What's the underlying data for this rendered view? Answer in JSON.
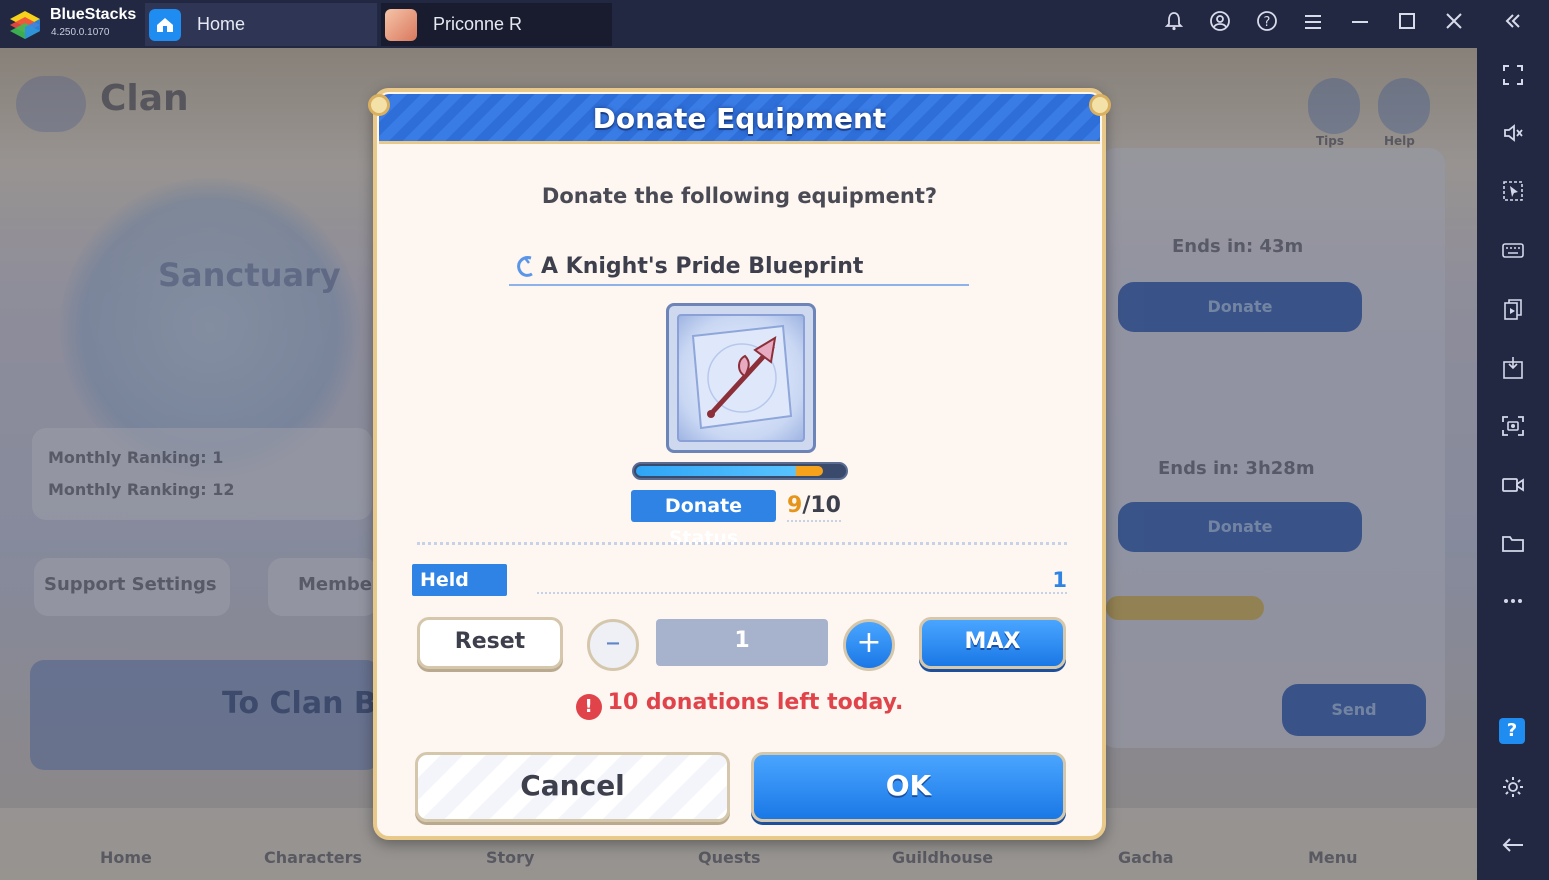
{
  "app": {
    "name": "BlueStacks",
    "version": "4.250.0.1070"
  },
  "tabs": [
    {
      "label": "Home",
      "icon": "home-icon"
    },
    {
      "label": "Priconne R",
      "icon": "game-avatar-icon"
    }
  ],
  "titlebar_icons": [
    "bell-icon",
    "account-icon",
    "help-icon",
    "hamburger-menu-icon",
    "minimize-icon",
    "maximize-icon",
    "close-icon",
    "collapse-sidebar-icon"
  ],
  "sidebar_icons": [
    "fullscreen-icon",
    "volume-mute-icon",
    "pointer-selection-icon",
    "keyboard-icon",
    "multi-instance-icon",
    "apk-install-icon",
    "screenshot-icon",
    "record-video-icon",
    "folder-icon",
    "more-icon",
    "help-icon",
    "settings-gear-icon",
    "back-arrow-icon"
  ],
  "background": {
    "screen_title": "Clan",
    "clan_crest_label": "Sanctuary",
    "rankings": [
      "Monthly Ranking: 1",
      "Monthly Ranking: 12"
    ],
    "buttons": [
      "Support Settings",
      "Membe"
    ],
    "to_clan_label": "To Clan B",
    "right_icons": [
      "Tips",
      "Help"
    ],
    "requests": [
      {
        "timer": "Ends in: 43m",
        "button": "Donate"
      },
      {
        "timer": "Ends in: 3h28m",
        "button": "Donate"
      }
    ],
    "send_button": "Send",
    "bottom_nav": [
      "Home",
      "Characters",
      "Story",
      "Quests",
      "Guildhouse",
      "Gacha",
      "Menu"
    ]
  },
  "dialog": {
    "title": "Donate Equipment",
    "question": "Donate the following equipment?",
    "item_name": "A Knight's Pride Blueprint",
    "progress_fraction": 0.9,
    "status_label": "Donate Status",
    "status_current": "9",
    "status_total": "/10",
    "held_label": "Held",
    "held_value": "1",
    "reset_label": "Reset",
    "minus_symbol": "–",
    "quantity": "1",
    "plus_symbol": "+",
    "max_label": "MAX",
    "warning_symbol": "!",
    "warning_text": "10 donations left today.",
    "cancel_label": "Cancel",
    "ok_label": "OK"
  },
  "colors": {
    "header_blue": "#2e6ed8",
    "accent_blue": "#2f83e4",
    "warning_red": "#e1434a",
    "gold_border": "#e8c98a",
    "status_orange": "#e5951b"
  }
}
